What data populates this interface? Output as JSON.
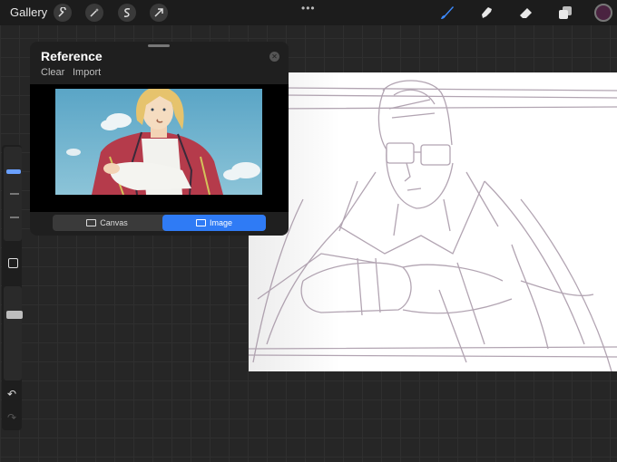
{
  "toolbar": {
    "gallery_label": "Gallery",
    "left_tools": [
      "wrench-icon",
      "magic-wand-icon",
      "selection-s-icon",
      "transform-arrow-icon"
    ],
    "more_dots": "•••",
    "right_tools": [
      "brush-icon",
      "smudge-icon",
      "eraser-icon",
      "layers-icon"
    ],
    "active_tool": "brush-icon",
    "current_color": "#4a2340",
    "accent_color": "#2f7bf5"
  },
  "sidebar": {
    "brush_size_level": 0.15,
    "opacity_level": 0.3,
    "undo_icon": "undo-icon",
    "redo_icon": "redo-icon"
  },
  "reference": {
    "title": "Reference",
    "clear_label": "Clear",
    "import_label": "Import",
    "tabs": [
      {
        "label": "Canvas",
        "active": false
      },
      {
        "label": "Image",
        "active": true
      }
    ]
  }
}
